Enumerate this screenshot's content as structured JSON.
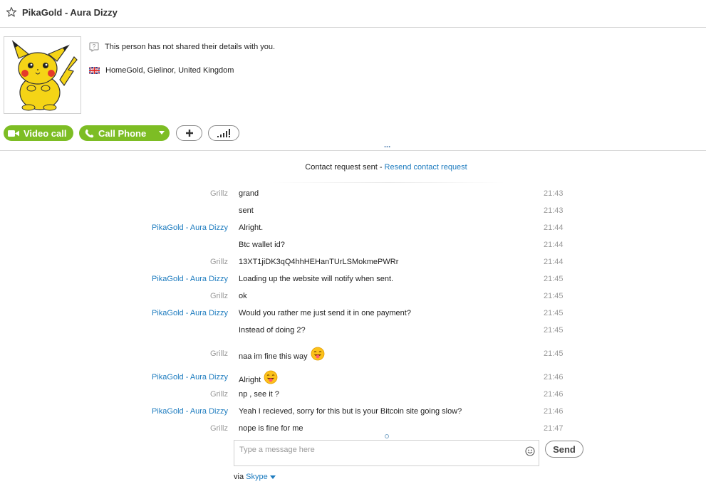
{
  "header": {
    "title": "PikaGold - Aura Dizzy",
    "favorite_icon": "star-icon"
  },
  "profile": {
    "privacy_text": "This person has not shared their details with you.",
    "location": "HomeGold, Gielinor, United Kingdom",
    "avatar": "pikachu-avatar"
  },
  "actions": {
    "video_call": "Video call",
    "call_phone": "Call Phone"
  },
  "expand_label": "...",
  "contact_request": {
    "status": "Contact request sent - ",
    "resend": "Resend contact request"
  },
  "messages": [
    {
      "sender": "Grillz",
      "text": "grand",
      "time": "21:43"
    },
    {
      "sender": "",
      "text": "sent",
      "time": "21:43"
    },
    {
      "sender": "PikaGold - Aura Dizzy",
      "text": "Alright.",
      "time": "21:44"
    },
    {
      "sender": "",
      "text": "Btc wallet id?",
      "time": "21:44"
    },
    {
      "sender": "Grillz",
      "text": "13XT1jiDK3qQ4hhHEHanTUrLSMokmePWRr",
      "time": "21:44"
    },
    {
      "sender": "PikaGold - Aura Dizzy",
      "text": "Loading up the website will notify when sent.",
      "time": "21:45"
    },
    {
      "sender": "Grillz",
      "text": "ok",
      "time": "21:45"
    },
    {
      "sender": "PikaGold - Aura Dizzy",
      "text": "Would you rather me just send it in one payment?",
      "time": "21:45"
    },
    {
      "sender": "",
      "text": "Instead of doing 2?",
      "time": "21:45"
    },
    {
      "sender": "Grillz",
      "text": "naa im fine this way",
      "time": "21:45",
      "emoji": "tongue-smiley-icon"
    },
    {
      "sender": "PikaGold - Aura Dizzy",
      "text": "Alright",
      "time": "21:46",
      "emoji": "tongue-smiley-icon"
    },
    {
      "sender": "Grillz",
      "text": "np , see it ?",
      "time": "21:46"
    },
    {
      "sender": "PikaGold - Aura Dizzy",
      "text": "Yeah I recieved, sorry for this but is your Bitcoin site going slow?",
      "time": "21:46"
    },
    {
      "sender": "Grillz",
      "text": "nope is fine for me",
      "time": "21:47"
    }
  ],
  "composer": {
    "placeholder": "Type a message here",
    "value": "",
    "send_label": "Send"
  },
  "via": {
    "prefix": "via ",
    "service": "Skype"
  },
  "colors": {
    "accent_green": "#7dbd24",
    "link_blue": "#1e7cbf"
  }
}
